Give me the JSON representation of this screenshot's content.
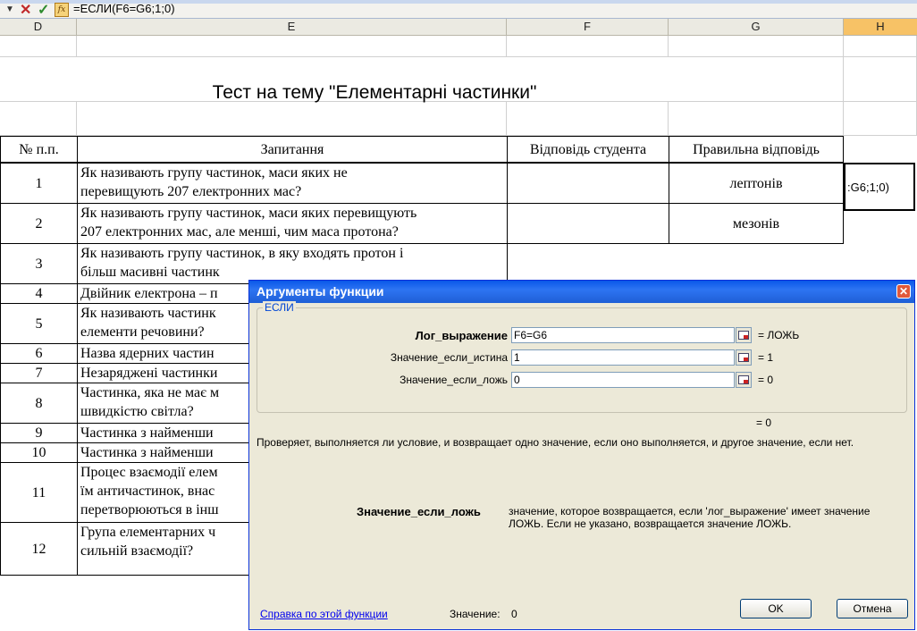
{
  "formula_bar": {
    "cancel_icon": "✕",
    "enter_icon": "✓",
    "fx_label": "fx",
    "formula": "=ЕСЛИ(F6=G6;1;0)"
  },
  "columns": [
    "D",
    "E",
    "F",
    "G",
    "H"
  ],
  "active_column": "H",
  "sheet": {
    "title": "Тест на тему \"Елементарні частинки\"",
    "headers": {
      "num": "№ п.п.",
      "question": "Запитання",
      "student": "Відповідь студента",
      "correct": "Правильна відповідь"
    },
    "edit_cell_text": ":G6;1;0)",
    "rows": [
      {
        "num": "1",
        "question": "Як називають групу частинок, маси яких не\nперевищують 207 електронних мас?",
        "answer": "лептонів"
      },
      {
        "num": "2",
        "question": "Як називають групу частинок, маси яких перевищують\n207 електронних мас, але менші, чим маса протона?",
        "answer": "мезонів"
      },
      {
        "num": "3",
        "question": "Як називають групу частинок, в яку входять протон і\nбільш масивні частинк",
        "answer": ""
      },
      {
        "num": "4",
        "question": "Двійник електрона – п",
        "answer": ""
      },
      {
        "num": "5",
        "question": "Як називають частинк\nелементи речовини?",
        "answer": ""
      },
      {
        "num": "6",
        "question": "Назва ядерних частин",
        "answer": ""
      },
      {
        "num": "7",
        "question": "Незаряджені частинки",
        "answer": ""
      },
      {
        "num": "8",
        "question": "Частинка, яка не має м\nшвидкістю світла?",
        "answer": ""
      },
      {
        "num": "9",
        "question": "Частинка з найменши",
        "answer": ""
      },
      {
        "num": "10",
        "question": "Частинка з найменши",
        "answer": ""
      },
      {
        "num": "11",
        "question": "Процес взаємодії елем\nїм античастинок, внас\nперетворюються в інш",
        "answer": ""
      },
      {
        "num": "12",
        "question": "Група елементарних ч\nсильній взаємодії?",
        "answer": ""
      }
    ]
  },
  "dialog": {
    "title": "Аргументы функции",
    "close_icon": "✕",
    "function_name": "ЕСЛИ",
    "args": [
      {
        "label": "Лог_выражение",
        "value": "F6=G6",
        "result": "= ЛОЖЬ",
        "bold": true
      },
      {
        "label": "Значение_если_истина",
        "value": "1",
        "result": "= 1",
        "bold": false
      },
      {
        "label": "Значение_если_ложь",
        "value": "0",
        "result": "= 0",
        "bold": false
      }
    ],
    "formula_result": "= 0",
    "description": "Проверяет, выполняется ли условие, и возвращает одно значение, если оно выполняется, и другое значение, если нет.",
    "arg_help_name": "Значение_если_ложь",
    "arg_help_text": "значение, которое возвращается, если 'лог_выражение' имеет значение ЛОЖЬ. Если не указано, возвращается значение ЛОЖЬ.",
    "help_link": "Справка по этой функции",
    "value_label": "Значение:",
    "value": "0",
    "ok_label": "OK",
    "cancel_label": "Отмена"
  }
}
